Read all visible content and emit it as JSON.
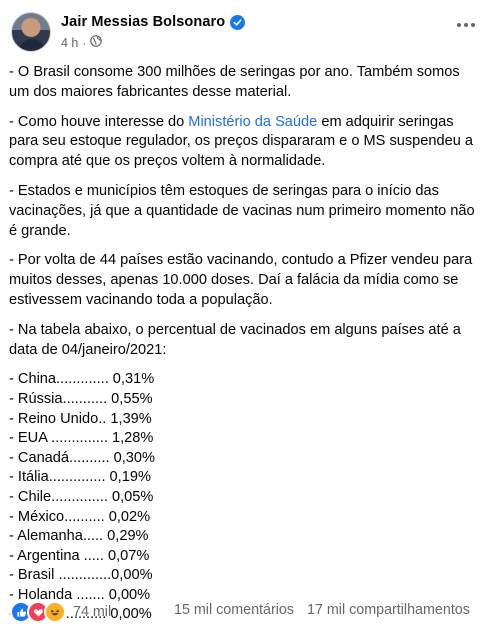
{
  "post": {
    "author": "Jair Messias Bolsonaro",
    "time": "4 h",
    "time_separator": "·",
    "paragraphs": [
      {
        "before": "- O Brasil consome 300 milhões de seringas por ano. Também somos um dos maiores fabricantes desse material.",
        "link": "",
        "after": ""
      },
      {
        "before": "- Como houve interesse do ",
        "link": "Ministério da Saúde",
        "after": " em adquirir seringas para seu estoque regulador, os preços dispararam e o MS suspendeu a compra até que os preços voltem à normalidade."
      },
      {
        "before": "- Estados e municípios têm estoques de seringas para o início das vacinações, já que a quantidade de vacinas num primeiro momento não é grande.",
        "link": "",
        "after": ""
      },
      {
        "before": "- Por volta de 44 países estão vacinando, contudo a Pfizer vendeu para muitos desses, apenas 10.000 doses. Daí a falácia da mídia  como se estivessem vacinando toda a população.",
        "link": "",
        "after": ""
      },
      {
        "before": "- Na tabela abaixo, o percentual de vacinados em alguns países até a data de 04/janeiro/2021:",
        "link": "",
        "after": ""
      }
    ],
    "table_rows": [
      "- China............. 0,31%",
      "- Rússia........... 0,55%",
      "- Reino Unido.. 1,39%",
      "- EUA .............. 1,28%",
      "- Canadá.......... 0,30%",
      "- Itália.............. 0,19%",
      "- Chile.............. 0,05%",
      "- México.......... 0,02%",
      "- Alemanha..... 0,29%",
      "- Argentina ..... 0,07%",
      "- Brasil .............0,00%",
      "- Holanda ....... 0,00%",
      "- Japão  .......... 0,00%"
    ]
  },
  "footer": {
    "reaction_count": "74 mil",
    "comments": "15 mil comentários",
    "shares": "17 mil compartilhamentos",
    "reaction_icons": [
      "like-icon",
      "love-icon",
      "haha-icon"
    ]
  },
  "colors": {
    "link": "#216fdb",
    "verified": "#1877f2",
    "secondary_text": "#65676b"
  }
}
